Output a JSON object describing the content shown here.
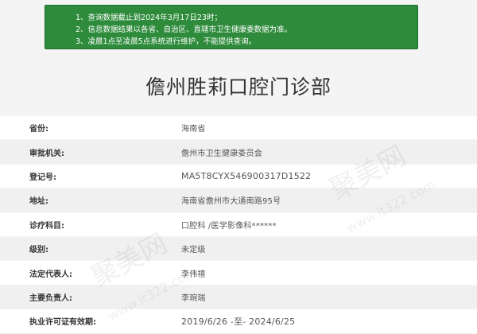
{
  "notice": {
    "lines": [
      "1、查询数据截止到2024年3月17日23时；",
      "2、信息数据结果以各省、自治区、直辖市卫生健康委数据为准。",
      "3、凌晨1点至凌晨5点系统进行维护，不能提供查询。"
    ]
  },
  "clinic": {
    "name": "儋州胜莉口腔门诊部"
  },
  "details": [
    {
      "label": "省份:",
      "value": "海南省"
    },
    {
      "label": "审批机关:",
      "value": "儋州市卫生健康委员会"
    },
    {
      "label": "登记号:",
      "value": "MA5T8CYX546900317D1522"
    },
    {
      "label": "地址:",
      "value": "海南省儋州市大通南路95号"
    },
    {
      "label": "诊疗科目:",
      "value": "口腔科 /医学影像科******"
    },
    {
      "label": "级别:",
      "value": "未定级"
    },
    {
      "label": "法定代表人:",
      "value": "李伟禧"
    },
    {
      "label": "主要负责人:",
      "value": "李琬瑞"
    },
    {
      "label": "执业许可证有效期:",
      "value": "2019/6/26 -至- 2024/6/25"
    }
  ],
  "watermark": {
    "brand": "聚美网",
    "site": "www.it322.com"
  }
}
